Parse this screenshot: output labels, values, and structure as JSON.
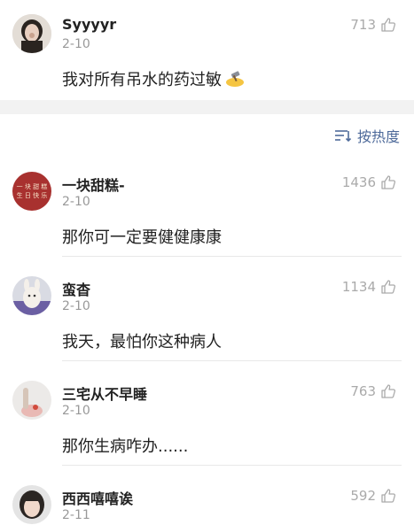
{
  "top_comment": {
    "user": "Syyyyr",
    "date": "2-10",
    "likes": "713",
    "text": "我对所有吊水的药过敏",
    "emoji": "hammer-emoji"
  },
  "sort": {
    "label": "按热度",
    "icon": "sort-icon"
  },
  "comments": [
    {
      "user": "一块甜糕-",
      "date": "2-10",
      "likes": "1436",
      "text": "那你可一定要健健康康"
    },
    {
      "user": "蛮杳",
      "date": "2-10",
      "likes": "1134",
      "text": "我天，最怕你这种病人"
    },
    {
      "user": "三宅从不早睡",
      "date": "2-10",
      "likes": "763",
      "text": "那你生病咋办......"
    },
    {
      "user": "西西嘻嘻诶",
      "date": "2-11",
      "likes": "592",
      "text": ""
    }
  ],
  "colors": {
    "link_blue": "#4e6a9a",
    "meta_gray": "#999999",
    "band_gray": "#f2f2f2"
  }
}
